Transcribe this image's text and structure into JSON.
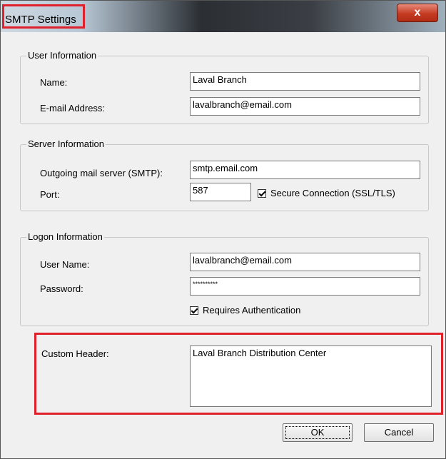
{
  "window": {
    "title": "SMTP Settings",
    "close_glyph": "x"
  },
  "user_info": {
    "legend": "User Information",
    "name_label": "Name:",
    "name_value": "Laval Branch",
    "email_label": "E-mail Address:",
    "email_value": "lavalbranch@email.com"
  },
  "server_info": {
    "legend": "Server Information",
    "smtp_label": "Outgoing mail server (SMTP):",
    "smtp_value": "smtp.email.com",
    "port_label": "Port:",
    "port_value": "587",
    "secure_label": "Secure Connection (SSL/TLS)",
    "secure_checked": true
  },
  "logon_info": {
    "legend": "Logon Information",
    "username_label": "User Name:",
    "username_value": "lavalbranch@email.com",
    "password_label": "Password:",
    "password_value": "**********",
    "auth_label": "Requires Authentication",
    "auth_checked": true
  },
  "custom_header": {
    "label": "Custom Header:",
    "value": "Laval Branch Distribution Center"
  },
  "buttons": {
    "ok": "OK",
    "cancel": "Cancel"
  },
  "colors": {
    "highlight": "#e0202a",
    "close_button": "#c43b22"
  }
}
